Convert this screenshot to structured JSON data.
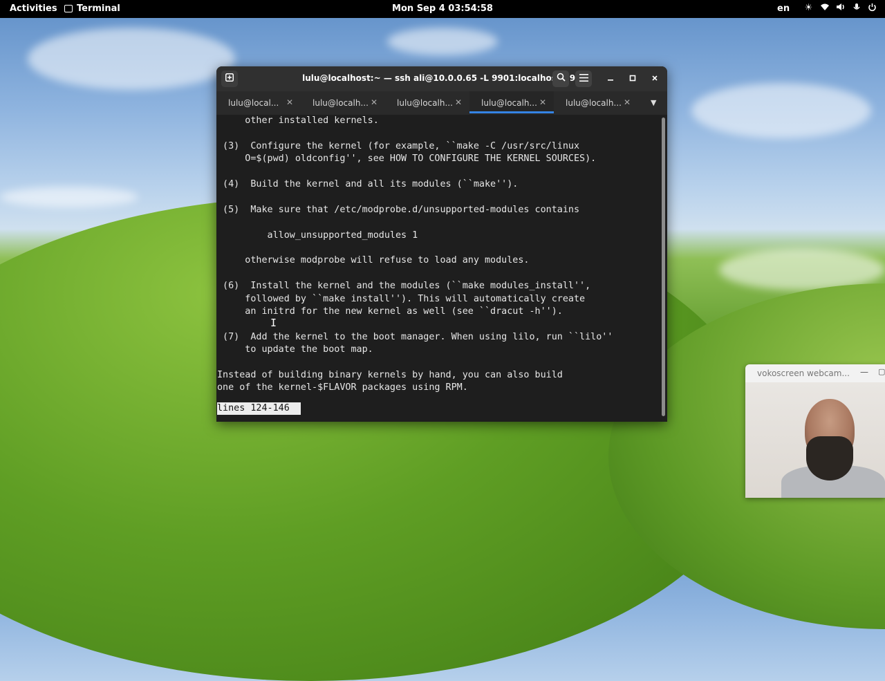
{
  "topbar": {
    "activities": "Activities",
    "app_name": "Terminal",
    "clock": "Mon Sep 4  03:54:58",
    "language": "en",
    "tray_icons": [
      "brightness-icon",
      "wifi-icon",
      "volume-icon",
      "microphone-icon",
      "power-icon"
    ]
  },
  "terminal": {
    "title": "lulu@localhost:~ — ssh ali@10.0.0.65 -L 9901:localhost:5901",
    "tabs": [
      {
        "label": "lulu@local...",
        "active": false
      },
      {
        "label": "lulu@localh...",
        "active": false
      },
      {
        "label": "lulu@localh...",
        "active": false
      },
      {
        "label": "lulu@localh...",
        "active": true
      },
      {
        "label": "lulu@localh...",
        "active": false
      }
    ],
    "lines": [
      "     other installed kernels.",
      "",
      " (3)  Configure the kernel (for example, ``make -C /usr/src/linux",
      "     O=$(pwd) oldconfig'', see HOW TO CONFIGURE THE KERNEL SOURCES).",
      "",
      " (4)  Build the kernel and all its modules (``make'').",
      "",
      " (5)  Make sure that /etc/modprobe.d/unsupported-modules contains",
      "",
      "         allow_unsupported_modules 1",
      "",
      "     otherwise modprobe will refuse to load any modules.",
      "",
      " (6)  Install the kernel and the modules (``make modules_install'',",
      "     followed by ``make install''). This will automatically create",
      "     an initrd for the new kernel as well (see ``dracut -h'').",
      "",
      " (7)  Add the kernel to the boot manager. When using lilo, run ``lilo''",
      "     to update the boot map.",
      "",
      "Instead of building binary kernels by hand, you can also build",
      "one of the kernel-$FLAVOR packages using RPM."
    ],
    "status": "lines 124-146 "
  },
  "webcam": {
    "title": "vokoscreen webcam..."
  }
}
